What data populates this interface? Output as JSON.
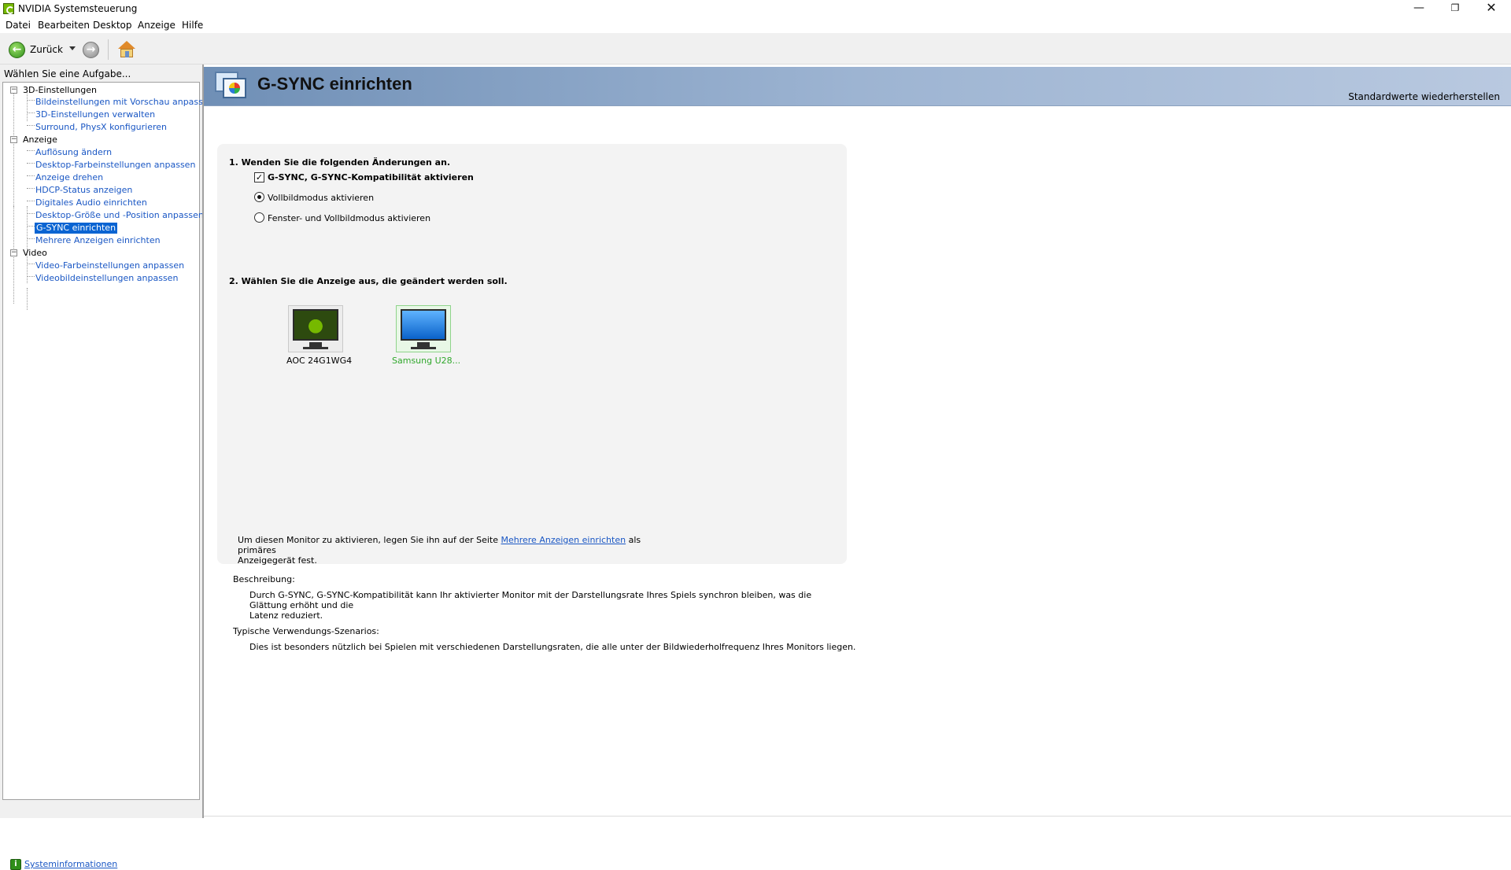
{
  "window": {
    "title": "NVIDIA Systemsteuerung",
    "minimize": "—",
    "maximize": "❐",
    "close": "✕"
  },
  "menu": [
    "Datei",
    "Bearbeiten",
    "Desktop",
    "Anzeige",
    "Hilfe"
  ],
  "toolbar": {
    "back_label": "Zurück",
    "back_icon": "arrow-left-icon",
    "forward_icon": "arrow-right-icon",
    "home_icon": "home-icon"
  },
  "sidebar": {
    "header": "Wählen Sie eine Aufgabe...",
    "categories": [
      {
        "label": "3D-Einstellungen",
        "items": [
          "Bildeinstellungen mit Vorschau anpassen",
          "3D-Einstellungen verwalten",
          "Surround, PhysX konfigurieren"
        ]
      },
      {
        "label": "Anzeige",
        "items": [
          "Auflösung ändern",
          "Desktop-Farbeinstellungen anpassen",
          "Anzeige drehen",
          "HDCP-Status anzeigen",
          "Digitales Audio einrichten",
          "Desktop-Größe und -Position anpassen",
          "G-SYNC einrichten",
          "Mehrere Anzeigen einrichten"
        ]
      },
      {
        "label": "Video",
        "items": [
          "Video-Farbeinstellungen anpassen",
          "Videobildeinstellungen anpassen"
        ]
      }
    ],
    "selected": "G-SYNC einrichten",
    "system_info": "Systeminformationen"
  },
  "page": {
    "title": "G-SYNC einrichten",
    "restore_defaults": "Standardwerte wiederherstellen",
    "step1": {
      "title": "1. Wenden Sie die folgenden Änderungen an.",
      "checkbox_label": "G-SYNC, G-SYNC-Kompatibilität aktivieren",
      "checkbox_checked": true,
      "radio_fullscreen": "Vollbildmodus aktivieren",
      "radio_windowed": "Fenster- und Vollbildmodus aktivieren",
      "selected_radio": "Vollbildmodus aktivieren"
    },
    "step2": {
      "title": "2. Wählen Sie die Anzeige aus, die geändert werden soll.",
      "displays": [
        {
          "label": "AOC 24G1WG4",
          "active": false
        },
        {
          "label": "Samsung U28...",
          "active": true
        }
      ]
    },
    "note": {
      "before": "Um diesen Monitor zu aktivieren, legen Sie ihn auf der Seite ",
      "link": "Mehrere Anzeigen einrichten",
      "after": " als primäres",
      "line2": "Anzeigegerät fest."
    },
    "description_label": "Beschreibung:",
    "description_text_1": "Durch G-SYNC, G-SYNC-Kompatibilität kann Ihr aktivierter Monitor mit der Darstellungsrate Ihres Spiels synchron bleiben, was die Glättung erhöht und die",
    "description_text_2": "Latenz reduziert.",
    "usage_label": "Typische Verwendungs-Szenarios:",
    "usage_text": "Dies ist besonders nützlich bei Spielen mit verschiedenen Darstellungsraten, die alle unter der Bildwiederholfrequenz Ihres Monitors liegen."
  },
  "colors": {
    "accent_green": "#76b900",
    "link_blue": "#1a57c4",
    "selection_blue": "#0a64d2",
    "active_display_green": "#30a82c"
  }
}
